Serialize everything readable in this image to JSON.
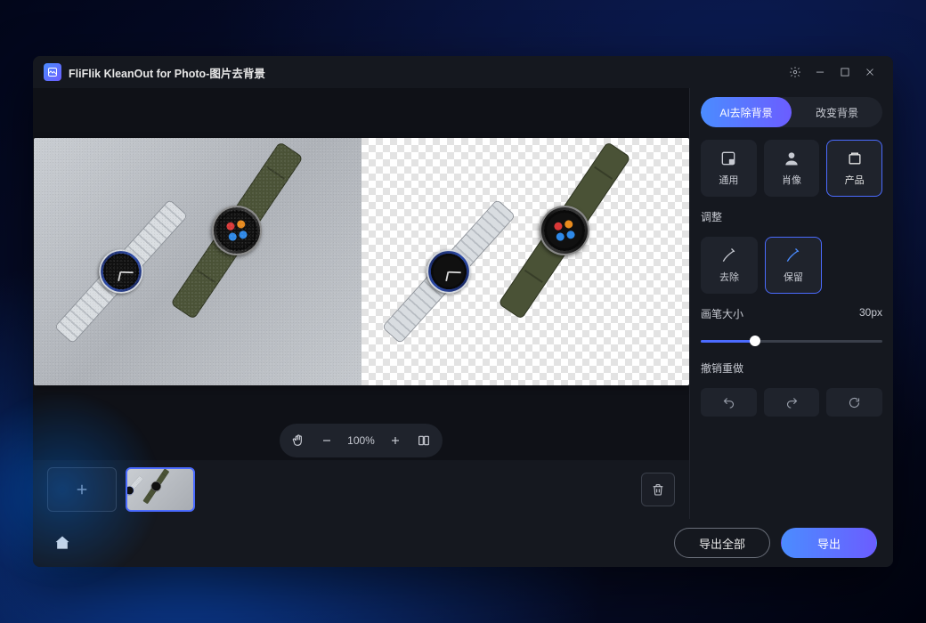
{
  "titlebar": {
    "title": "FliFlik KleanOut for Photo-图片去背景"
  },
  "zoom": {
    "level": "100%"
  },
  "footer": {
    "export_all": "导出全部",
    "export": "导出"
  },
  "sidebar": {
    "tabs": {
      "ai_remove": "AI去除背景",
      "change_bg": "改变背景"
    },
    "categories": {
      "general": "通用",
      "portrait": "肖像",
      "product": "产品"
    },
    "adjust_label": "调整",
    "adjust": {
      "erase": "去除",
      "keep": "保留"
    },
    "brush": {
      "label": "画笔大小",
      "value": "30px",
      "percent": 30
    },
    "undo_label": "撤销重做"
  }
}
